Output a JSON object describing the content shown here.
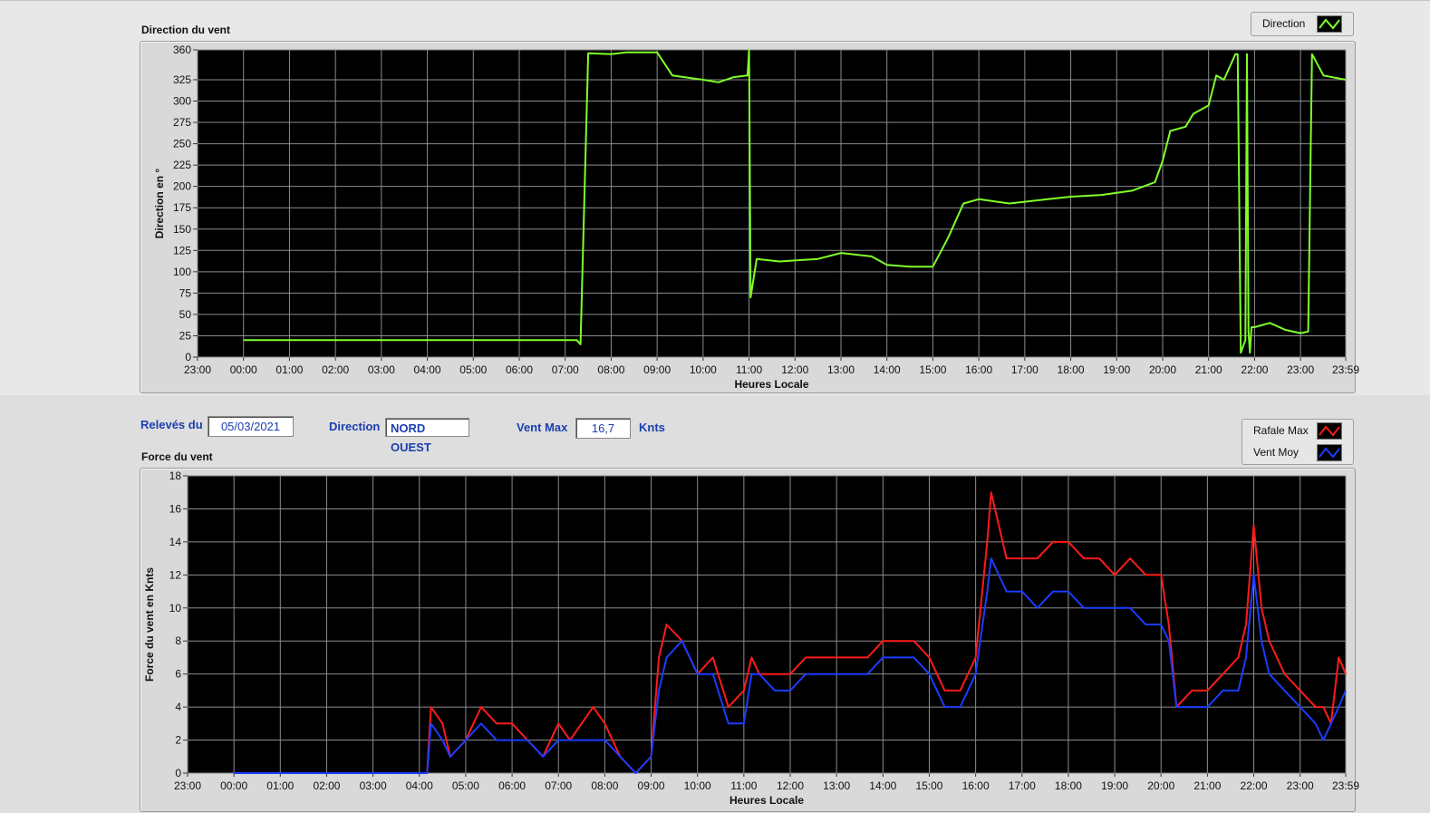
{
  "direction_chart": {
    "title": "Direction du vent",
    "legend": [
      {
        "label": "Direction",
        "color": "#7fff2a",
        "icon": "line-swatch-icon"
      }
    ]
  },
  "force_chart": {
    "title": "Force du vent",
    "legend": [
      {
        "label": "Rafale Max",
        "color": "#ff1a1a",
        "icon": "line-swatch-icon"
      },
      {
        "label": "Vent Moy",
        "color": "#1a3cff",
        "icon": "line-swatch-icon"
      }
    ]
  },
  "controls": {
    "date_label": "Relevés du",
    "date_value": "05/03/2021",
    "direction_label": "Direction",
    "direction_value": "NORD OUEST",
    "ventmax_label": "Vent Max",
    "ventmax_value": "16,7",
    "unit": "Knts"
  },
  "chart_data": [
    {
      "type": "line",
      "title": "Direction du vent",
      "xlabel": "Heures Locale",
      "ylabel": "Direction en °",
      "x_tick_labels": [
        "23:00",
        "00:00",
        "01:00",
        "02:00",
        "03:00",
        "04:00",
        "05:00",
        "06:00",
        "07:00",
        "08:00",
        "09:00",
        "10:00",
        "11:00",
        "12:00",
        "13:00",
        "14:00",
        "15:00",
        "16:00",
        "17:00",
        "18:00",
        "19:00",
        "20:00",
        "21:00",
        "22:00",
        "23:00",
        "23:59"
      ],
      "x_range": [
        "23:00",
        "23:59"
      ],
      "ylim": [
        0,
        360
      ],
      "y_ticks": [
        0,
        25,
        50,
        75,
        100,
        125,
        150,
        175,
        200,
        225,
        250,
        275,
        300,
        325,
        360
      ],
      "grid": true,
      "legend_position": "top-right",
      "series": [
        {
          "name": "Direction",
          "color": "#7fff2a",
          "x": [
            "00:00",
            "07:15",
            "07:20",
            "07:30",
            "08:00",
            "08:20",
            "09:00",
            "09:20",
            "10:00",
            "10:20",
            "10:40",
            "10:58",
            "11:00",
            "11:02",
            "11:10",
            "11:40",
            "12:30",
            "13:00",
            "13:40",
            "14:00",
            "14:30",
            "15:00",
            "15:20",
            "15:40",
            "16:00",
            "16:40",
            "17:00",
            "17:30",
            "18:00",
            "18:40",
            "19:20",
            "19:50",
            "20:00",
            "20:10",
            "20:30",
            "20:40",
            "21:00",
            "21:10",
            "21:20",
            "21:35",
            "21:38",
            "21:42",
            "21:48",
            "21:50",
            "21:52",
            "21:54",
            "21:56",
            "22:00",
            "22:20",
            "22:40",
            "23:00",
            "23:10",
            "23:15",
            "23:30",
            "23:59"
          ],
          "values": [
            20,
            20,
            15,
            356,
            355,
            357,
            357,
            330,
            325,
            322,
            328,
            330,
            360,
            70,
            115,
            112,
            115,
            122,
            118,
            108,
            106,
            106,
            140,
            180,
            185,
            180,
            182,
            185,
            188,
            190,
            195,
            205,
            230,
            265,
            270,
            285,
            295,
            330,
            325,
            355,
            355,
            5,
            20,
            355,
            30,
            5,
            35,
            35,
            40,
            32,
            28,
            30,
            355,
            330,
            325
          ]
        }
      ]
    },
    {
      "type": "line",
      "title": "Force du vent",
      "xlabel": "Heures Locale",
      "ylabel": "Force du vent en Knts",
      "x_tick_labels": [
        "23:00",
        "00:00",
        "01:00",
        "02:00",
        "03:00",
        "04:00",
        "05:00",
        "06:00",
        "07:00",
        "08:00",
        "09:00",
        "10:00",
        "11:00",
        "12:00",
        "13:00",
        "14:00",
        "15:00",
        "16:00",
        "17:00",
        "18:00",
        "19:00",
        "20:00",
        "21:00",
        "22:00",
        "23:00",
        "23:59"
      ],
      "x_range": [
        "23:00",
        "23:59"
      ],
      "ylim": [
        0,
        18
      ],
      "y_ticks": [
        0,
        2,
        4,
        6,
        8,
        10,
        12,
        14,
        16,
        18
      ],
      "grid": true,
      "legend_position": "top-right",
      "series": [
        {
          "name": "Rafale Max",
          "color": "#ff1a1a",
          "x": [
            "00:00",
            "04:10",
            "04:15",
            "04:30",
            "04:40",
            "05:00",
            "05:20",
            "05:40",
            "06:00",
            "06:20",
            "06:40",
            "07:00",
            "07:15",
            "07:30",
            "07:45",
            "08:00",
            "08:20",
            "08:40",
            "09:00",
            "09:10",
            "09:20",
            "09:40",
            "10:00",
            "10:20",
            "10:40",
            "11:00",
            "11:10",
            "11:20",
            "11:40",
            "12:00",
            "12:20",
            "12:40",
            "13:00",
            "13:20",
            "13:40",
            "14:00",
            "14:20",
            "14:40",
            "15:00",
            "15:20",
            "15:40",
            "16:00",
            "16:15",
            "16:20",
            "16:40",
            "17:00",
            "17:20",
            "17:40",
            "18:00",
            "18:20",
            "18:40",
            "19:00",
            "19:20",
            "19:40",
            "20:00",
            "20:10",
            "20:20",
            "20:40",
            "21:00",
            "21:20",
            "21:40",
            "21:50",
            "22:00",
            "22:10",
            "22:20",
            "22:40",
            "23:00",
            "23:20",
            "23:30",
            "23:40",
            "23:50",
            "23:59"
          ],
          "values": [
            0,
            0,
            4,
            3,
            1,
            2,
            4,
            3,
            3,
            2,
            1,
            3,
            2,
            3,
            4,
            3,
            1,
            0,
            1,
            7,
            9,
            8,
            6,
            7,
            4,
            5,
            7,
            6,
            6,
            6,
            7,
            7,
            7,
            7,
            7,
            8,
            8,
            8,
            7,
            5,
            5,
            7,
            14,
            17,
            13,
            13,
            13,
            14,
            14,
            13,
            13,
            12,
            13,
            12,
            12,
            9,
            4,
            5,
            5,
            6,
            7,
            9,
            15,
            10,
            8,
            6,
            5,
            4,
            4,
            3,
            7,
            6
          ]
        },
        {
          "name": "Vent Moy",
          "color": "#1a3cff",
          "x": [
            "00:00",
            "04:10",
            "04:15",
            "04:30",
            "04:40",
            "05:00",
            "05:20",
            "05:40",
            "06:00",
            "06:20",
            "06:40",
            "07:00",
            "07:15",
            "07:30",
            "07:45",
            "08:00",
            "08:20",
            "08:40",
            "09:00",
            "09:10",
            "09:20",
            "09:40",
            "10:00",
            "10:20",
            "10:40",
            "11:00",
            "11:10",
            "11:20",
            "11:40",
            "12:00",
            "12:20",
            "12:40",
            "13:00",
            "13:20",
            "13:40",
            "14:00",
            "14:20",
            "14:40",
            "15:00",
            "15:20",
            "15:40",
            "16:00",
            "16:15",
            "16:20",
            "16:40",
            "17:00",
            "17:20",
            "17:40",
            "18:00",
            "18:20",
            "18:40",
            "19:00",
            "19:20",
            "19:40",
            "20:00",
            "20:10",
            "20:20",
            "20:40",
            "21:00",
            "21:20",
            "21:40",
            "21:50",
            "22:00",
            "22:10",
            "22:20",
            "22:40",
            "23:00",
            "23:20",
            "23:30",
            "23:40",
            "23:50",
            "23:59"
          ],
          "values": [
            0,
            0,
            3,
            2,
            1,
            2,
            3,
            2,
            2,
            2,
            1,
            2,
            2,
            2,
            2,
            2,
            1,
            0,
            1,
            5,
            7,
            8,
            6,
            6,
            3,
            3,
            6,
            6,
            5,
            5,
            6,
            6,
            6,
            6,
            6,
            7,
            7,
            7,
            6,
            4,
            4,
            6,
            11,
            13,
            11,
            11,
            10,
            11,
            11,
            10,
            10,
            10,
            10,
            9,
            9,
            8,
            4,
            4,
            4,
            5,
            5,
            7,
            12,
            8,
            6,
            5,
            4,
            3,
            2,
            3,
            4,
            5
          ]
        }
      ]
    }
  ]
}
